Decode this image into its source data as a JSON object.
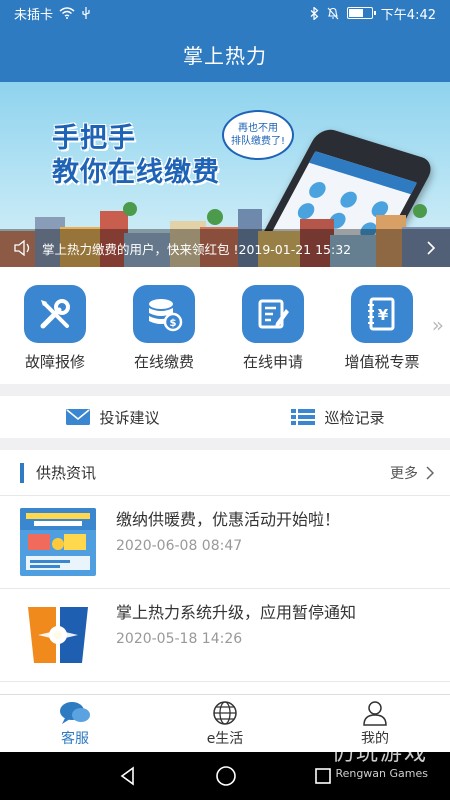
{
  "status_bar": {
    "carrier": "未插卡",
    "time": "下午4:42"
  },
  "header": {
    "title": "掌上热力"
  },
  "banner": {
    "headline_line1": "手把手",
    "headline_line2": "教你在线缴费",
    "bubble_line1": "再也不用",
    "bubble_line2": "排队缴费了!",
    "ticker": "掌上热力缴费的用户，快来领红包 !2019-01-21 15:32"
  },
  "services": [
    {
      "label": "故障报修",
      "icon": "wrench-screwdriver-icon"
    },
    {
      "label": "在线缴费",
      "icon": "coins-icon"
    },
    {
      "label": "在线申请",
      "icon": "edit-document-icon"
    },
    {
      "label": "增值税专票",
      "icon": "yen-notebook-icon"
    }
  ],
  "secondary": [
    {
      "label": "投诉建议",
      "icon": "mail-icon"
    },
    {
      "label": "巡检记录",
      "icon": "list-icon"
    }
  ],
  "news": {
    "title": "供热资讯",
    "more": "更多",
    "items": [
      {
        "title": "缴纳供暖费，优惠活动开始啦！",
        "date": "2020-06-08 08:47"
      },
      {
        "title": "掌上热力系统升级，应用暂停通知",
        "date": "2020-05-18 14:26"
      }
    ]
  },
  "tabs": [
    {
      "label": "客服",
      "icon": "chat-icon",
      "active": true
    },
    {
      "label": "e生活",
      "icon": "globe-icon",
      "active": false
    },
    {
      "label": "我的",
      "icon": "person-icon",
      "active": false
    }
  ],
  "watermark": {
    "line1": "仍玩游戏",
    "line2": "Rengwan Games"
  },
  "colors": {
    "primary": "#2f7bc1",
    "icon_bg": "#3b86d0"
  }
}
